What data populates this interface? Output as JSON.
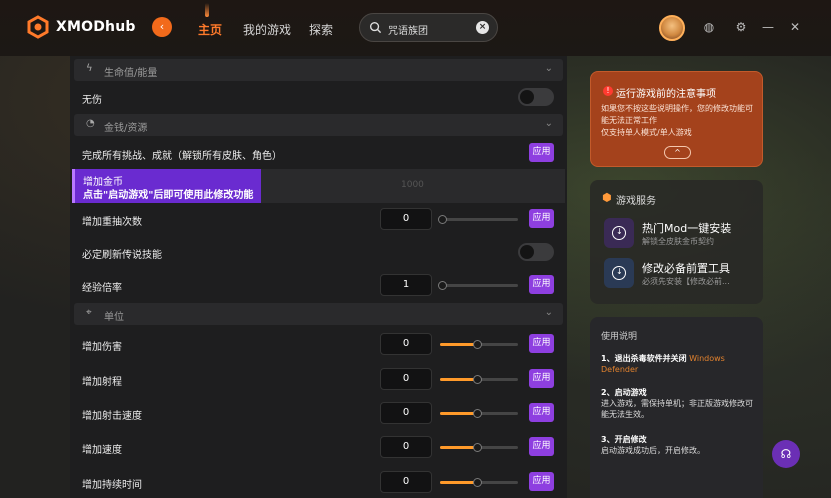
{
  "header": {
    "brand": "XMODhub",
    "nav": [
      "主页",
      "我的游戏",
      "探索"
    ],
    "search_value": "咒语族团",
    "back_icon": "back-arrow-icon",
    "clear_icon": "×"
  },
  "sections": {
    "health": "生命值/能量",
    "money": "金钱/资源",
    "unit": "单位"
  },
  "rows": {
    "no_damage": "无伤",
    "complete_all": "完成所有挑战、成就（解锁所有皮肤、角色）",
    "add_gold": "增加金币",
    "add_gold_hint": "点击\"启动游戏\"后即可使用此修改功能",
    "add_gold_value": "1000",
    "add_reroll": "增加重抽次数",
    "add_reroll_value": "0",
    "refresh_legend": "必定刷新传说技能",
    "exp_rate": "经验倍率",
    "exp_rate_value": "1",
    "add_damage": "增加伤害",
    "add_damage_value": "0",
    "add_range": "增加射程",
    "add_range_value": "0",
    "add_fire_rate": "增加射击速度",
    "add_fire_rate_value": "0",
    "add_speed": "增加速度",
    "add_speed_value": "0",
    "add_duration": "增加持续时间",
    "add_duration_value": "0"
  },
  "apply_label": "应用",
  "notice": {
    "title": "运行游戏前的注意事项",
    "body1": "如果您不按这些说明操作，您的修改功能可能无法正常工作",
    "body2": "仅支持单人模式/单人游戏",
    "button": "^"
  },
  "services": {
    "title": "游戏服务",
    "items": [
      {
        "name": "热门Mod一键安装",
        "sub": "解锁全皮肤金币契约"
      },
      {
        "name": "修改必备前置工具",
        "sub": "必须先安装【修改必前..."
      }
    ]
  },
  "guide": {
    "title": "使用说明",
    "step1_title": "1、退出杀毒软件并关闭",
    "step1_orange": "Windows Defender",
    "step2_title": "2、启动游戏",
    "step2_body": "进入游戏，需保持单机；非正版游戏修改可能无法生效。",
    "step3_title": "3、开启修改",
    "step3_body": "启动游戏成功后，开启修改。"
  },
  "sliders": {
    "damage": 0.45,
    "range": 0.45,
    "fire_rate": 0.45,
    "speed": 0.45,
    "duration": 0.45,
    "reroll": 0.0
  },
  "colors": {
    "accent": "#ff7a2a",
    "apply": "#8e3fe0",
    "notice": "#a4421c"
  }
}
